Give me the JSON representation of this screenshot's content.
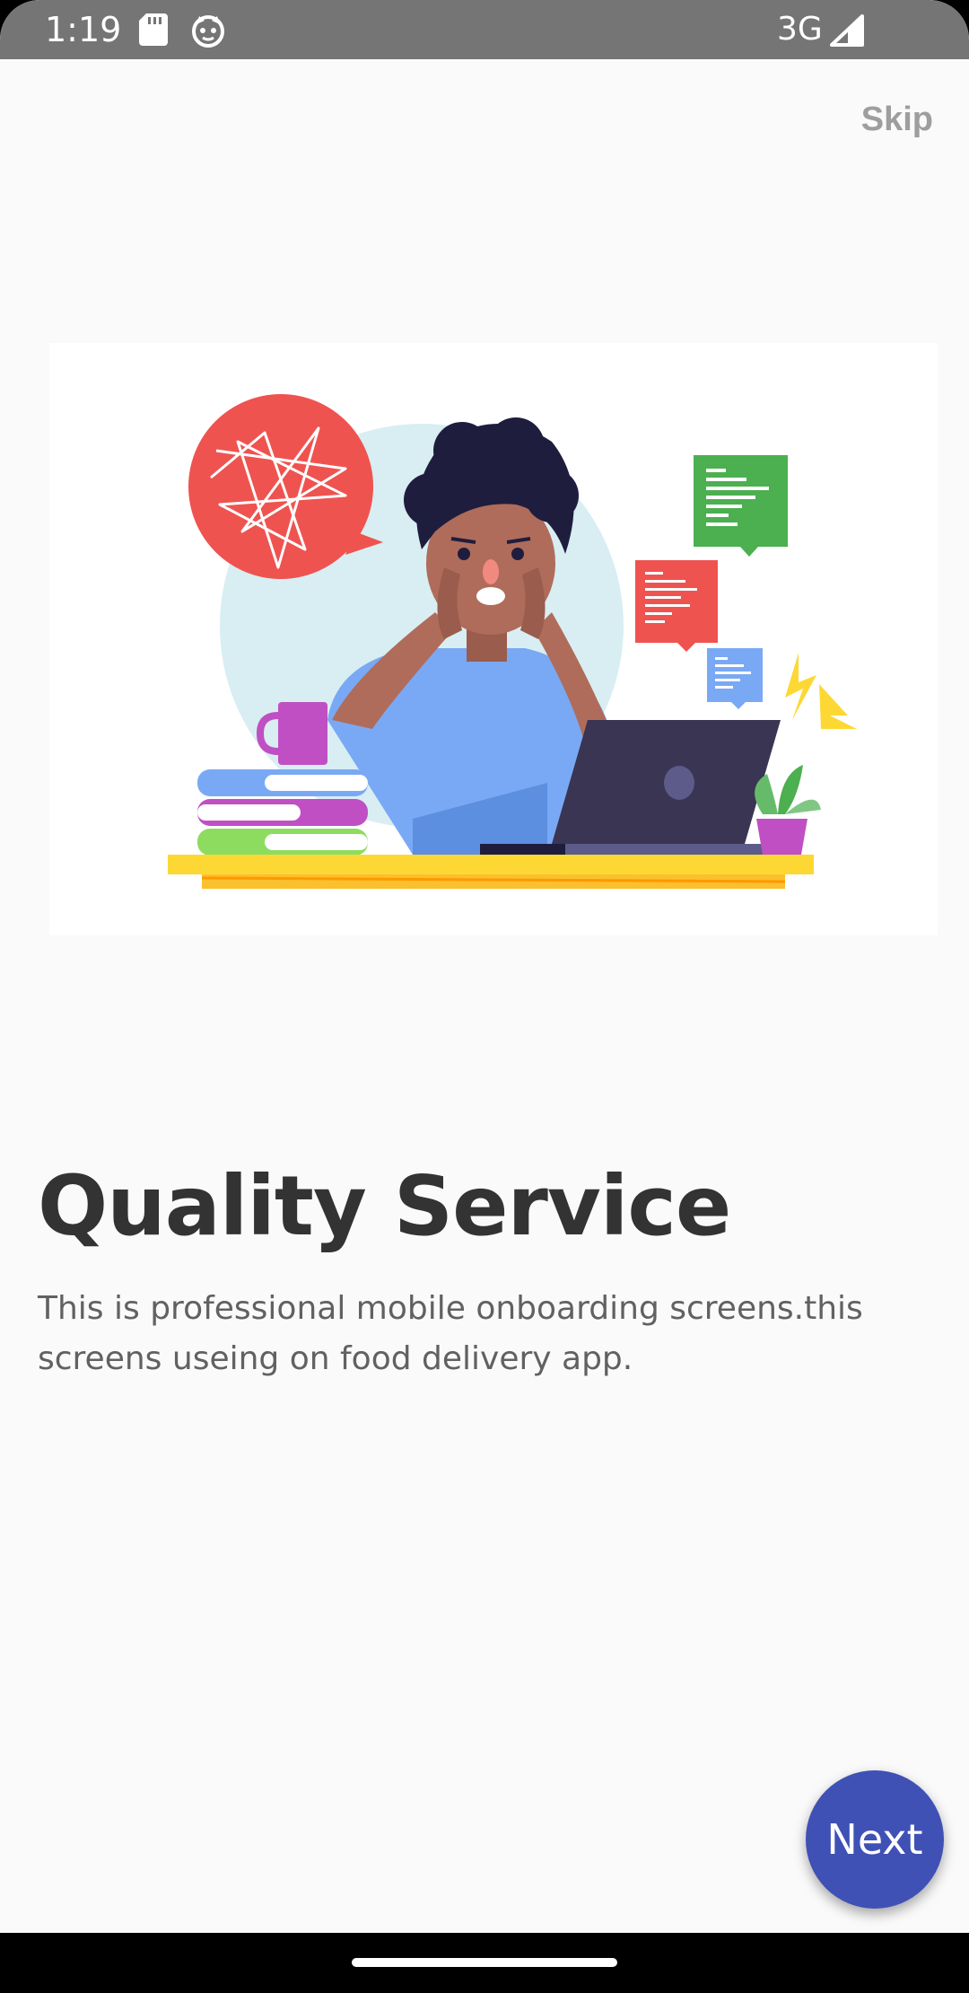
{
  "status_bar": {
    "time": "1:19",
    "network": "3G",
    "icons": [
      "sd-card-icon",
      "cat-notification-icon",
      "signal-icon"
    ]
  },
  "onboarding": {
    "skip_label": "Skip",
    "title": "Quality Service",
    "description": "This is professional mobile onboarding screens.this screens useing on food delivery app.",
    "next_label": "Next"
  },
  "colors": {
    "status_bar": "#757575",
    "background": "#fafafa",
    "accent": "#3f51b5",
    "title": "#333333",
    "description": "#616161",
    "skip": "#9e9e9e"
  }
}
